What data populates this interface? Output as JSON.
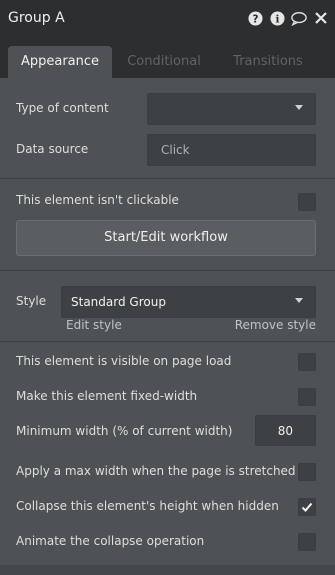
{
  "header": {
    "title": "Group A",
    "icons": [
      "help-icon",
      "info-icon",
      "comment-icon",
      "close-icon"
    ]
  },
  "tabs": [
    {
      "label": "Appearance",
      "active": true
    },
    {
      "label": "Conditional",
      "active": false
    },
    {
      "label": "Transitions",
      "active": false
    }
  ],
  "content": {
    "type_label": "Type of content",
    "type_value": "",
    "source_label": "Data source",
    "source_value": "Click"
  },
  "clickable": {
    "label": "This element isn't clickable",
    "checked": false,
    "workflow_button": "Start/Edit workflow"
  },
  "style": {
    "label": "Style",
    "value": "Standard Group",
    "edit_link": "Edit style",
    "remove_link": "Remove style"
  },
  "options": {
    "visible_label": "This element is visible on page load",
    "fixed_width_label": "Make this element fixed-width",
    "min_width_label": "Minimum width (% of current width)",
    "min_width_value": "80",
    "max_width_label": "Apply a max width when the page is stretched",
    "collapse_label": "Collapse this element's height when hidden",
    "collapse_checked": true,
    "animate_label": "Animate the collapse operation"
  },
  "colors": {
    "panel_bg": "#4f5254",
    "header_bg": "#2c2e30",
    "field_bg": "#3e4143"
  }
}
